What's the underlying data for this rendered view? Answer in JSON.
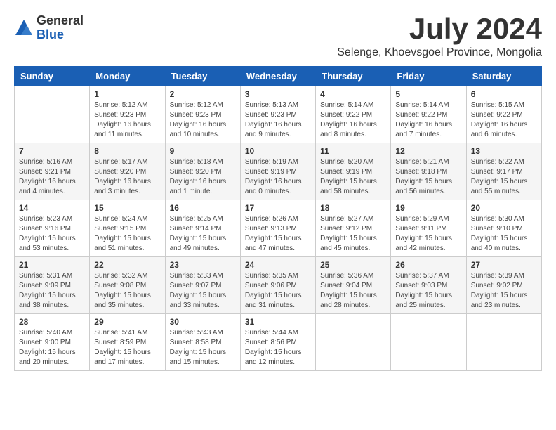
{
  "logo": {
    "general": "General",
    "blue": "Blue"
  },
  "title": {
    "month": "July 2024",
    "location": "Selenge, Khoevsgoel Province, Mongolia"
  },
  "headers": [
    "Sunday",
    "Monday",
    "Tuesday",
    "Wednesday",
    "Thursday",
    "Friday",
    "Saturday"
  ],
  "weeks": [
    [
      {
        "day": "",
        "info": ""
      },
      {
        "day": "1",
        "info": "Sunrise: 5:12 AM\nSunset: 9:23 PM\nDaylight: 16 hours\nand 11 minutes."
      },
      {
        "day": "2",
        "info": "Sunrise: 5:12 AM\nSunset: 9:23 PM\nDaylight: 16 hours\nand 10 minutes."
      },
      {
        "day": "3",
        "info": "Sunrise: 5:13 AM\nSunset: 9:23 PM\nDaylight: 16 hours\nand 9 minutes."
      },
      {
        "day": "4",
        "info": "Sunrise: 5:14 AM\nSunset: 9:22 PM\nDaylight: 16 hours\nand 8 minutes."
      },
      {
        "day": "5",
        "info": "Sunrise: 5:14 AM\nSunset: 9:22 PM\nDaylight: 16 hours\nand 7 minutes."
      },
      {
        "day": "6",
        "info": "Sunrise: 5:15 AM\nSunset: 9:22 PM\nDaylight: 16 hours\nand 6 minutes."
      }
    ],
    [
      {
        "day": "7",
        "info": "Sunrise: 5:16 AM\nSunset: 9:21 PM\nDaylight: 16 hours\nand 4 minutes."
      },
      {
        "day": "8",
        "info": "Sunrise: 5:17 AM\nSunset: 9:20 PM\nDaylight: 16 hours\nand 3 minutes."
      },
      {
        "day": "9",
        "info": "Sunrise: 5:18 AM\nSunset: 9:20 PM\nDaylight: 16 hours\nand 1 minute."
      },
      {
        "day": "10",
        "info": "Sunrise: 5:19 AM\nSunset: 9:19 PM\nDaylight: 16 hours\nand 0 minutes."
      },
      {
        "day": "11",
        "info": "Sunrise: 5:20 AM\nSunset: 9:19 PM\nDaylight: 15 hours\nand 58 minutes."
      },
      {
        "day": "12",
        "info": "Sunrise: 5:21 AM\nSunset: 9:18 PM\nDaylight: 15 hours\nand 56 minutes."
      },
      {
        "day": "13",
        "info": "Sunrise: 5:22 AM\nSunset: 9:17 PM\nDaylight: 15 hours\nand 55 minutes."
      }
    ],
    [
      {
        "day": "14",
        "info": "Sunrise: 5:23 AM\nSunset: 9:16 PM\nDaylight: 15 hours\nand 53 minutes."
      },
      {
        "day": "15",
        "info": "Sunrise: 5:24 AM\nSunset: 9:15 PM\nDaylight: 15 hours\nand 51 minutes."
      },
      {
        "day": "16",
        "info": "Sunrise: 5:25 AM\nSunset: 9:14 PM\nDaylight: 15 hours\nand 49 minutes."
      },
      {
        "day": "17",
        "info": "Sunrise: 5:26 AM\nSunset: 9:13 PM\nDaylight: 15 hours\nand 47 minutes."
      },
      {
        "day": "18",
        "info": "Sunrise: 5:27 AM\nSunset: 9:12 PM\nDaylight: 15 hours\nand 45 minutes."
      },
      {
        "day": "19",
        "info": "Sunrise: 5:29 AM\nSunset: 9:11 PM\nDaylight: 15 hours\nand 42 minutes."
      },
      {
        "day": "20",
        "info": "Sunrise: 5:30 AM\nSunset: 9:10 PM\nDaylight: 15 hours\nand 40 minutes."
      }
    ],
    [
      {
        "day": "21",
        "info": "Sunrise: 5:31 AM\nSunset: 9:09 PM\nDaylight: 15 hours\nand 38 minutes."
      },
      {
        "day": "22",
        "info": "Sunrise: 5:32 AM\nSunset: 9:08 PM\nDaylight: 15 hours\nand 35 minutes."
      },
      {
        "day": "23",
        "info": "Sunrise: 5:33 AM\nSunset: 9:07 PM\nDaylight: 15 hours\nand 33 minutes."
      },
      {
        "day": "24",
        "info": "Sunrise: 5:35 AM\nSunset: 9:06 PM\nDaylight: 15 hours\nand 31 minutes."
      },
      {
        "day": "25",
        "info": "Sunrise: 5:36 AM\nSunset: 9:04 PM\nDaylight: 15 hours\nand 28 minutes."
      },
      {
        "day": "26",
        "info": "Sunrise: 5:37 AM\nSunset: 9:03 PM\nDaylight: 15 hours\nand 25 minutes."
      },
      {
        "day": "27",
        "info": "Sunrise: 5:39 AM\nSunset: 9:02 PM\nDaylight: 15 hours\nand 23 minutes."
      }
    ],
    [
      {
        "day": "28",
        "info": "Sunrise: 5:40 AM\nSunset: 9:00 PM\nDaylight: 15 hours\nand 20 minutes."
      },
      {
        "day": "29",
        "info": "Sunrise: 5:41 AM\nSunset: 8:59 PM\nDaylight: 15 hours\nand 17 minutes."
      },
      {
        "day": "30",
        "info": "Sunrise: 5:43 AM\nSunset: 8:58 PM\nDaylight: 15 hours\nand 15 minutes."
      },
      {
        "day": "31",
        "info": "Sunrise: 5:44 AM\nSunset: 8:56 PM\nDaylight: 15 hours\nand 12 minutes."
      },
      {
        "day": "",
        "info": ""
      },
      {
        "day": "",
        "info": ""
      },
      {
        "day": "",
        "info": ""
      }
    ]
  ]
}
